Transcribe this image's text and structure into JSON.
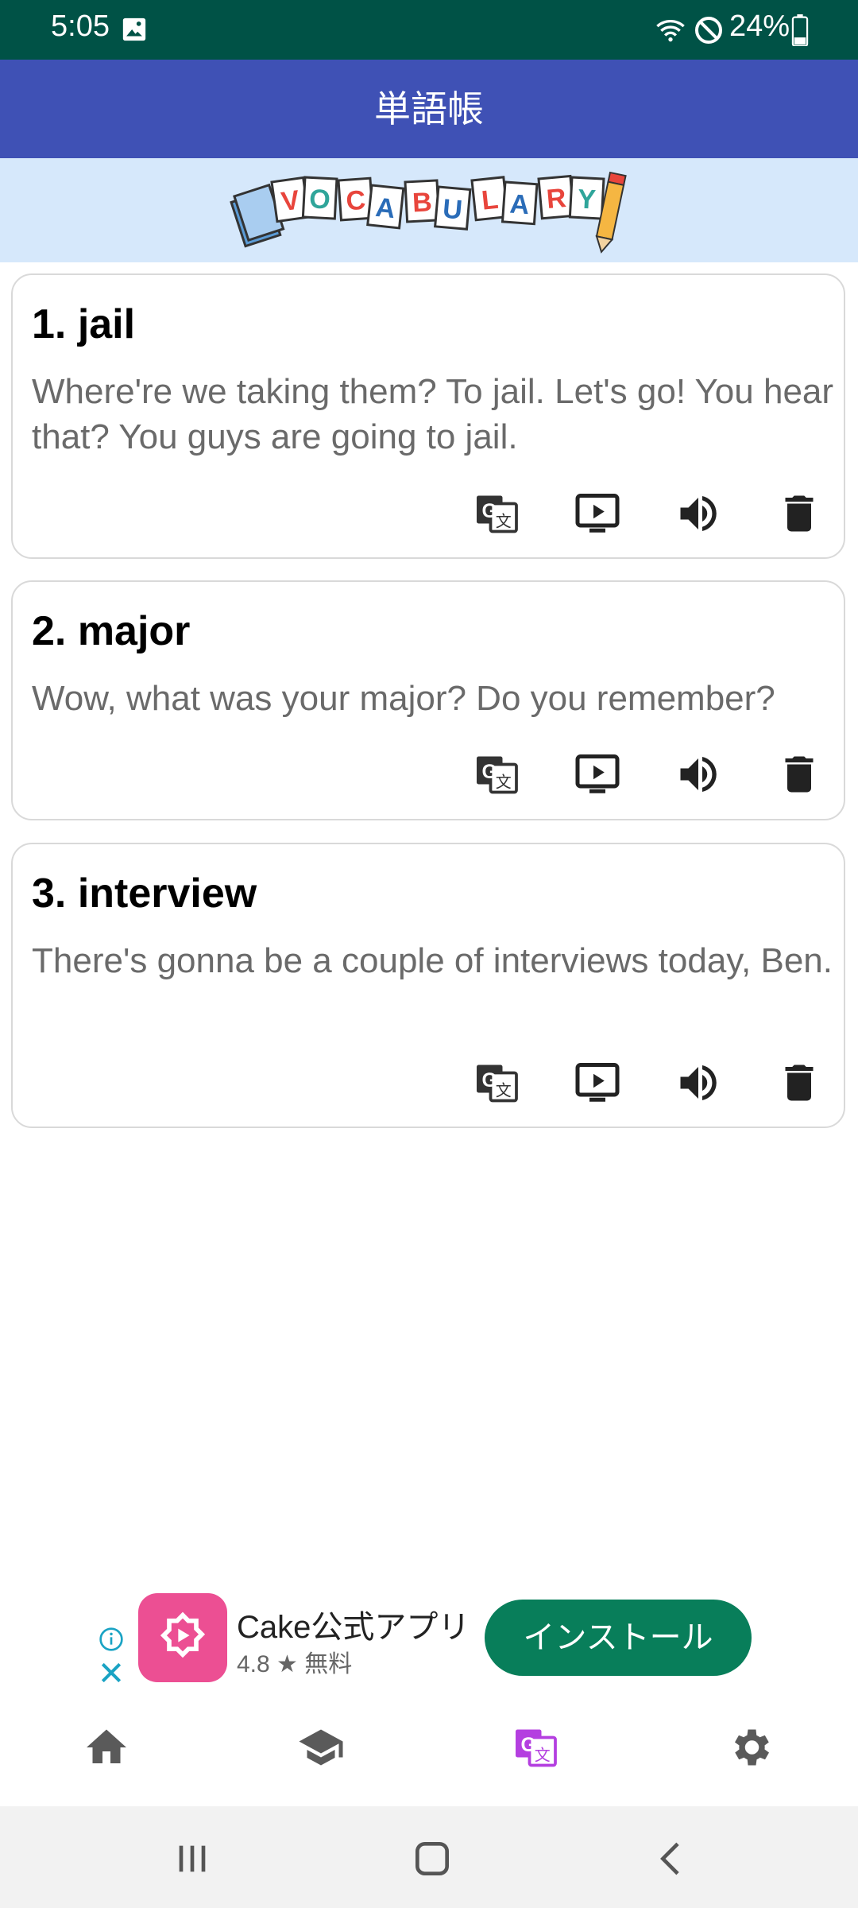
{
  "status_bar": {
    "time": "5:05",
    "battery": "24%",
    "icons": [
      "gallery-icon",
      "wifi-icon",
      "do-not-disturb-icon",
      "battery-icon"
    ]
  },
  "app_bar": {
    "title": "単語帳"
  },
  "banner": {
    "logo_text": "VOCABULARY"
  },
  "vocab_items": [
    {
      "word": "1. jail",
      "sentence": "Where're we taking them? To jail. Let's go! You hear that? You guys are going to jail."
    },
    {
      "word": "2. major",
      "sentence": "Wow, what was your major? Do you remember?"
    },
    {
      "word": "3. interview",
      "sentence": "There's gonna be a couple of interviews today, Ben."
    }
  ],
  "card_actions": [
    "translate-icon",
    "video-icon",
    "speaker-icon",
    "delete-icon"
  ],
  "ad": {
    "app_name": "Cake公式アプリ",
    "rating": "4.8 ★ 無料",
    "install_label": "インストール"
  },
  "bottom_nav": [
    "home-icon",
    "school-icon",
    "translate-icon",
    "settings-icon"
  ],
  "colors": {
    "status_bar": "#005246",
    "app_bar": "#3f51b5",
    "banner": "#d6e8fb",
    "active_nav": "#b43fe0",
    "install_button": "#087e5a"
  }
}
